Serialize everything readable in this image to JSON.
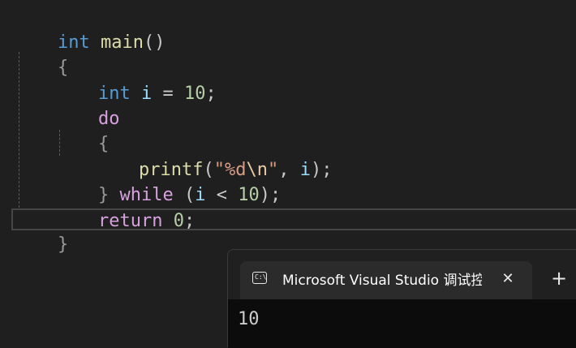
{
  "code": {
    "line1": {
      "type": "int",
      "name": "main",
      "parens": "()"
    },
    "line2": {
      "brace": "{"
    },
    "line3": {
      "type": "int",
      "var": "i",
      "op": "=",
      "value": "10",
      "semi": ";"
    },
    "line4": {
      "keyword": "do"
    },
    "line5": {
      "brace": "{"
    },
    "line6": {
      "fn": "printf",
      "open": "(",
      "q1": "\"",
      "fmt": "%d",
      "esc": "\\n",
      "q2": "\"",
      "comma": ",",
      "arg": "i",
      "close": ")",
      "semi": ";"
    },
    "line7": {
      "brace": "}",
      "keyword": "while",
      "open": "(",
      "var": "i",
      "op": "<",
      "value": "10",
      "close": ")",
      "semi": ";"
    },
    "line8": {
      "keyword": "return",
      "value": "0",
      "semi": ";"
    },
    "line9": {
      "brace": "}"
    }
  },
  "console": {
    "icon_glyph": "C:\\",
    "icon": "terminal-icon",
    "tab_title": "Microsoft Visual Studio 调试控制台",
    "close_glyph": "✕",
    "new_tab_glyph": "+",
    "output": "10"
  },
  "colors": {
    "background": "#1f1f1f",
    "keyword": "#569cd6",
    "control": "#d8a0df",
    "function": "#dcdcaa",
    "variable": "#9cdcfe",
    "number": "#b5cea8",
    "string": "#d69d85",
    "console_bg": "#0c0c0c"
  }
}
